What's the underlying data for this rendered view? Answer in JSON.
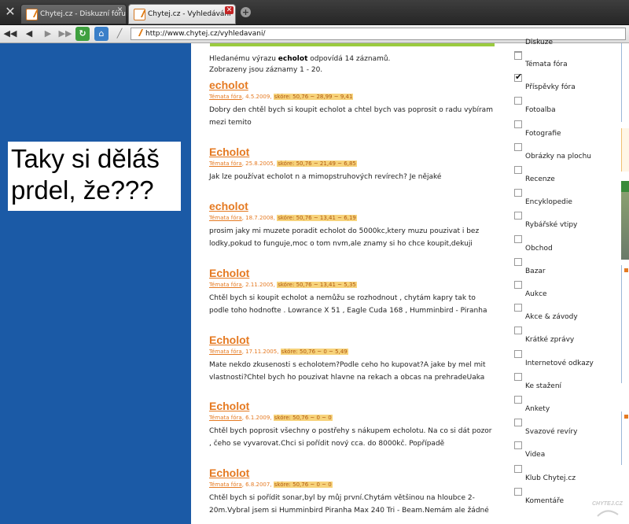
{
  "tabs": [
    {
      "title": "Chytej.cz - Diskuzní fóru...",
      "active": false
    },
    {
      "title": "Chytej.cz - Vyhledávání",
      "active": true
    }
  ],
  "address": "http://www.chytej.cz/vyhledavani/",
  "meme": "Taky si děláš\nprdel, že???",
  "summary": {
    "prefix": "Hledanému výrazu ",
    "term": "echolot",
    "suffix": " odpovídá 14 záznamů.",
    "line2": "Zobrazeny jsou záznamy 1 - 20."
  },
  "results": [
    {
      "title": "echolot",
      "category": "Témata fóra",
      "date": ", 4.5.2009, ",
      "score": "skóre: 50,76 ~ 28,99 ~ 9,41",
      "body": "Dobry den chtěl bych si koupit echolot a chtel bych vas poprosit o radu vybíram mezi temito"
    },
    {
      "title": "Echolot",
      "category": "Témata fóra",
      "date": ", 25.8.2005, ",
      "score": "skóre: 50,76 ~ 21,49 ~ 6,85",
      "body": "Jak lze používat echolot n a mimopstruhových revírech? Je nějaké"
    },
    {
      "title": "echolot",
      "category": "Témata fóra",
      "date": ", 18.7.2008, ",
      "score": "skóre: 50,76 ~ 13,41 ~ 6,19",
      "body": "prosim jaky mi muzete poradit echolot do 5000kc,ktery muzu pouzivat i bez lodky,pokud to funguje,moc o tom nvm,ale znamy si ho chce koupit,dekuji"
    },
    {
      "title": "Echolot",
      "category": "Témata fóra",
      "date": ", 2.11.2005, ",
      "score": "skóre: 50,76 ~ 13,41 ~ 5,35",
      "body": "Chtěl bych si koupit echolot a nemůžu se rozhodnout , chytám kapry tak to podle toho hodnoťte . Lowrance X 51 , Eagle Cuda 168 , Humminbird - Piranha"
    },
    {
      "title": "Echolot",
      "category": "Témata fóra",
      "date": ", 17.11.2005, ",
      "score": "skóre: 50,76 ~ 0 ~ 5,49",
      "body": "Mate nekdo zkusenosti s echolotem?Podle ceho ho kupovat?A jake by mel mit vlastnosti?Chtel bych ho pouzivat hlavne na rekach a obcas na prehradeUaka"
    },
    {
      "title": "Echolot",
      "category": "Témata fóra",
      "date": ", 6.1.2009, ",
      "score": "skóre: 50,76 ~ 0 ~ 0",
      "body": "Chtěl bych poprosit všechny o postřehy s nákupem echolotu. Na co si dát pozor , čeho se vyvarovat.Chci si pořídit nový cca. do 8000kč. Popřípadě"
    },
    {
      "title": "Echolot",
      "category": "Témata fóra",
      "date": ", 6.8.2007, ",
      "score": "skóre: 50,76 ~ 0 ~ 0",
      "body": "Chtěl bych si pořídit sonar,byl by můj první.Chytám většinou na hloubce 2-20m.Vybral jsem si Humminbird Piranha Max 240 Tri - Beam.Nemám ale žádné"
    }
  ],
  "filters": [
    {
      "label": "Diskuze",
      "checked": false
    },
    {
      "label": "Témata fóra",
      "checked": false
    },
    {
      "label": "Příspěvky fóra",
      "checked": true
    },
    {
      "label": "Fotoalba",
      "checked": false
    },
    {
      "label": "Fotografie",
      "checked": false
    },
    {
      "label": "Obrázky na plochu",
      "checked": false
    },
    {
      "label": "Recenze",
      "checked": false
    },
    {
      "label": "Encyklopedie",
      "checked": false
    },
    {
      "label": "Rybářské vtipy",
      "checked": false
    },
    {
      "label": "Obchod",
      "checked": false
    },
    {
      "label": "Bazar",
      "checked": false
    },
    {
      "label": "Aukce",
      "checked": false
    },
    {
      "label": "Akce & závody",
      "checked": false
    },
    {
      "label": "Krátké zprávy",
      "checked": false
    },
    {
      "label": "Internetové odkazy",
      "checked": false
    },
    {
      "label": "Ke stažení",
      "checked": false
    },
    {
      "label": "Ankety",
      "checked": false
    },
    {
      "label": "Svazové revíry",
      "checked": false
    },
    {
      "label": "Videa",
      "checked": false
    },
    {
      "label": "Klub Chytej.cz",
      "checked": false
    },
    {
      "label": "Komentáře",
      "checked": false
    }
  ],
  "logo_text": "CHYTEJ.CZ",
  "colors": {
    "accent": "#e57a22",
    "score_bg": "#f7d37b",
    "left_panel": "#1b5aa6",
    "green": "#9acb3f"
  }
}
